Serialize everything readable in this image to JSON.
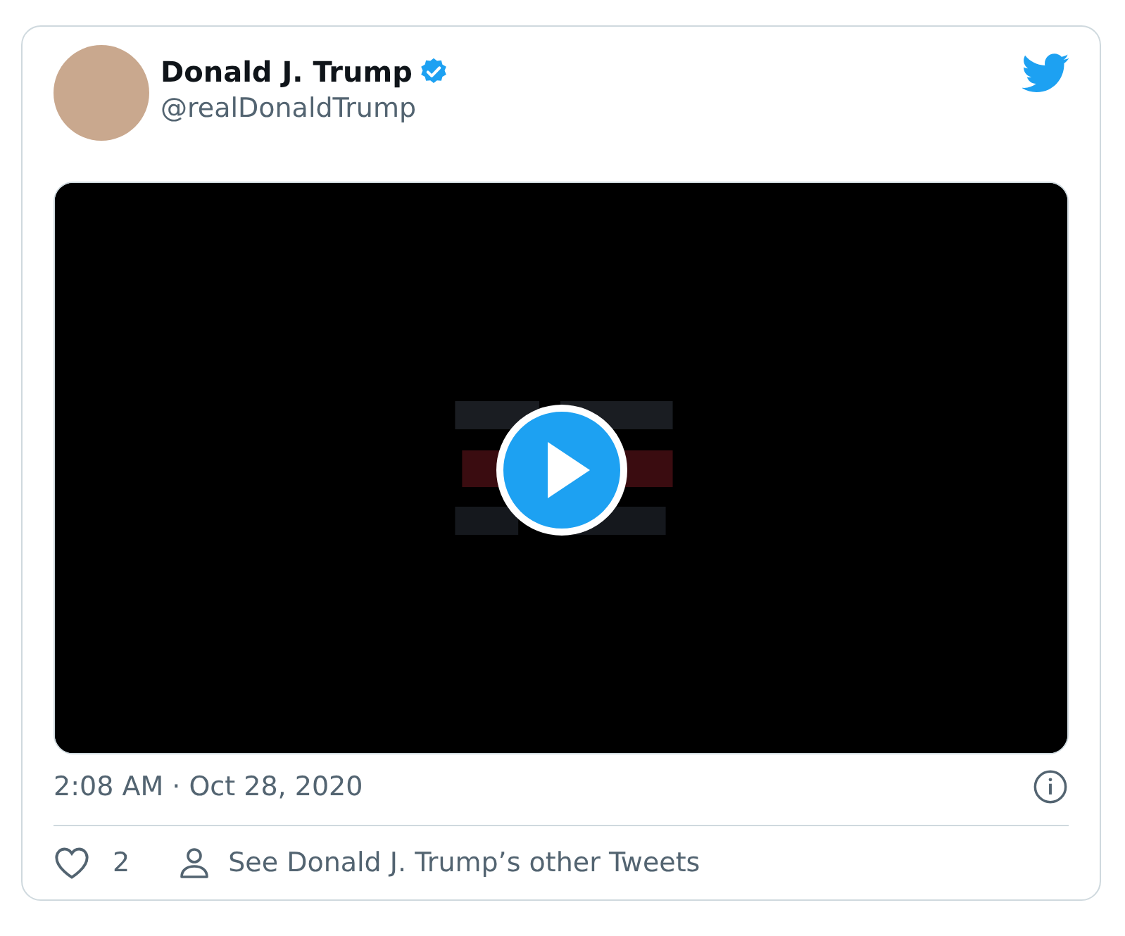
{
  "author": {
    "name": "Donald J. Trump",
    "verified": true,
    "handle": "@realDonaldTrump"
  },
  "timestamp": "2:08 AM · Oct 28, 2020",
  "actions": {
    "like_count": "2",
    "profile_link": "See Donald J. Trump’s other Tweets"
  }
}
